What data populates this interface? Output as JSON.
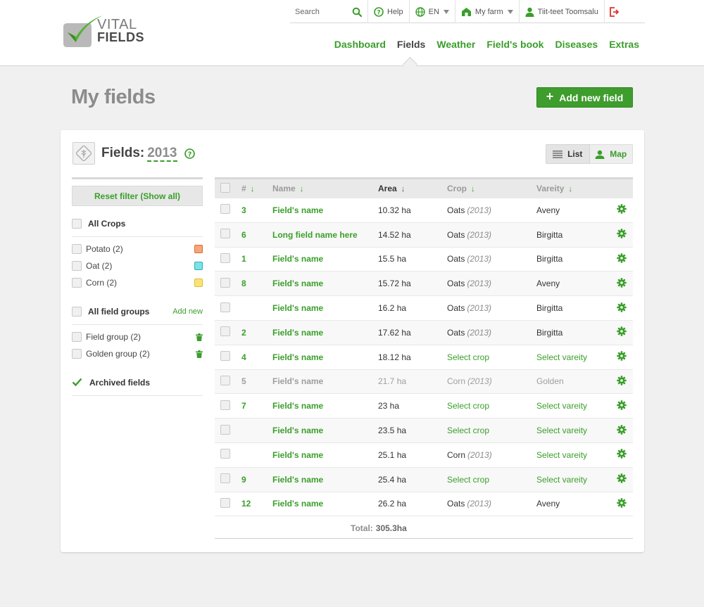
{
  "brand": {
    "line1": "VITAL",
    "line2": "FIELDS"
  },
  "topbar": {
    "search_label": "Search",
    "help_label": "Help",
    "language": "EN",
    "farm_label": "My farm",
    "user_name": "Tiit-teet Toomsalu"
  },
  "nav": {
    "items": [
      "Dashboard",
      "Fields",
      "Weather",
      "Field's book",
      "Diseases",
      "Extras"
    ],
    "active": "Fields"
  },
  "page": {
    "title": "My fields",
    "add_button": "Add new field"
  },
  "panel": {
    "title": "Fields:",
    "year": "2013",
    "view_list": "List",
    "view_map": "Map"
  },
  "sidebar": {
    "reset_label": "Reset filter (Show all)",
    "crops_title": "All Crops",
    "crops": [
      {
        "label": "Potato (2)",
        "color": "#f07a3c"
      },
      {
        "label": "Oat (2)",
        "color": "#38c9d2"
      },
      {
        "label": "Corn (2)",
        "color": "#f3d23a"
      }
    ],
    "groups_title": "All field groups",
    "groups_add": "Add new",
    "groups": [
      {
        "label": "Field group (2)"
      },
      {
        "label": "Golden group (2)"
      }
    ],
    "archived_label": "Archived fields",
    "archived_checked": true
  },
  "table": {
    "headers": {
      "num": "#",
      "name": "Name",
      "area": "Area",
      "crop": "Crop",
      "variety": "Vareity"
    },
    "rows": [
      {
        "num": "3",
        "name": "Field's name",
        "area": "10.32 ha",
        "crop": "Oats",
        "crop_year": "(2013)",
        "variety": "Aveny"
      },
      {
        "num": "6",
        "name": "Long field name here",
        "area": "14.52 ha",
        "crop": "Oats",
        "crop_year": "(2013)",
        "variety": "Birgitta"
      },
      {
        "num": "1",
        "name": "Field's name",
        "area": "15.5 ha",
        "crop": "Oats",
        "crop_year": "(2013)",
        "variety": "Birgitta"
      },
      {
        "num": "8",
        "name": "Field's name",
        "area": "15.72 ha",
        "crop": "Oats",
        "crop_year": "(2013)",
        "variety": "Aveny"
      },
      {
        "num": "",
        "name": "Field's name",
        "area": "16.2 ha",
        "crop": "Oats",
        "crop_year": "(2013)",
        "variety": "Birgitta"
      },
      {
        "num": "2",
        "name": "Field's name",
        "area": "17.62 ha",
        "crop": "Oats",
        "crop_year": "(2013)",
        "variety": "Birgitta"
      },
      {
        "num": "4",
        "name": "Field's name",
        "area": "18.12 ha",
        "crop": "Select crop",
        "crop_year": "",
        "variety": "Select vareity"
      },
      {
        "num": "5",
        "name": "Field's name",
        "area": "21.7 ha",
        "crop": "Corn",
        "crop_year": "(2013)",
        "variety": "Golden",
        "archived": true
      },
      {
        "num": "7",
        "name": "Field's name",
        "area": "23 ha",
        "crop": "Select crop",
        "crop_year": "",
        "variety": "Select vareity"
      },
      {
        "num": "",
        "name": "Field's name",
        "area": "23.5 ha",
        "crop": "Select crop",
        "crop_year": "",
        "variety": "Select vareity"
      },
      {
        "num": "",
        "name": "Field's name",
        "area": "25.1 ha",
        "crop": "Corn",
        "crop_year": "(2013)",
        "variety": "Select vareity"
      },
      {
        "num": "9",
        "name": "Field's name",
        "area": "25.4 ha",
        "crop": "Select crop",
        "crop_year": "",
        "variety": "Select vareity"
      },
      {
        "num": "12",
        "name": "Field's name",
        "area": "26.2 ha",
        "crop": "Oats",
        "crop_year": "(2013)",
        "variety": "Aveny"
      }
    ],
    "total_label": "Total:",
    "total_value": "305.3ha"
  },
  "colors": {
    "accent": "#3a9e2a",
    "button": "#3e9d2c",
    "muted": "#8c8c8c"
  }
}
